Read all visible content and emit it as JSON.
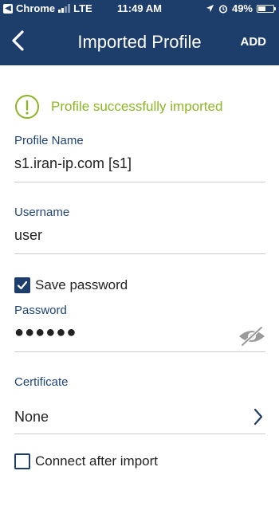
{
  "status_bar": {
    "carrier": "Chrome",
    "network": "LTE",
    "time": "11:49 AM",
    "battery": "49%",
    "battery_level": 0.49,
    "signal_bars": 2
  },
  "header": {
    "title": "Imported Profile",
    "add_label": "ADD"
  },
  "success": {
    "message": "Profile successfully imported"
  },
  "profile_name": {
    "label": "Profile Name",
    "value": "s1.iran-ip.com [s1]"
  },
  "username": {
    "label": "Username",
    "value": "user"
  },
  "save_password": {
    "label": "Save password",
    "checked": true
  },
  "password": {
    "label": "Password",
    "masked_value": "●●●●●●"
  },
  "certificate": {
    "label": "Certificate",
    "value": "None"
  },
  "connect_after_import": {
    "label": "Connect after import",
    "checked": false
  },
  "colors": {
    "header_bg": "#1d3d6b",
    "label": "#1f4478",
    "success": "#8cb526",
    "divider": "#cccccc"
  }
}
